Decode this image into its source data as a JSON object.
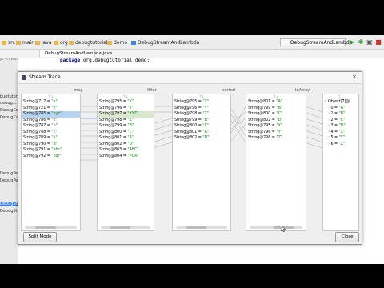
{
  "breadcrumbs": [
    {
      "label": "src"
    },
    {
      "label": "main"
    },
    {
      "label": "java"
    },
    {
      "label": "org"
    },
    {
      "label": "debugtutorial"
    },
    {
      "label": "demo"
    },
    {
      "label": "DebugStreamAndLambda"
    }
  ],
  "run_config": {
    "label": "DebugStreamAndLambda"
  },
  "editor_tab": {
    "label": "DebugStreamAndLambda.java"
  },
  "code_line": {
    "keyword": "package",
    "text": " org.debugtutorial.demo;"
  },
  "project_panel": {
    "path": "ju ~/Ideal.../tut/...",
    "items": [
      {
        "label": "bugtutorial"
      },
      {
        "label": "debug..."
      },
      {
        "label": "DebugCo"
      },
      {
        "label": "DebugCal"
      },
      {
        "label": "DebugPer"
      },
      {
        "label": "DebugPer"
      },
      {
        "label": "DebugStr"
      },
      {
        "label": "DebugStr"
      }
    ]
  },
  "dialog": {
    "title": "Stream Trace",
    "close_x": "×",
    "split_mode_label": "Split Mode",
    "close_label": "Close",
    "stages": [
      {
        "label": "map"
      },
      {
        "label": "filter"
      },
      {
        "label": "sorted"
      },
      {
        "label": "toArray"
      }
    ],
    "columns": [
      {
        "header": "↑↓",
        "rows": [
          {
            "obj": "String@717",
            "val": "\"a\""
          },
          {
            "obj": "String@721",
            "val": "\"y\""
          },
          {
            "obj": "String@785",
            "val": "\"xyz\""
          },
          {
            "obj": "String@786",
            "val": "\"z\""
          },
          {
            "obj": "String@787",
            "val": "\"b\""
          },
          {
            "obj": "String@788",
            "val": "\"c\""
          },
          {
            "obj": "String@789",
            "val": "\"a\""
          },
          {
            "obj": "String@790",
            "val": "\"d\""
          },
          {
            "obj": "String@791",
            "val": "\"abc\""
          },
          {
            "obj": "String@792",
            "val": "\"pqr\""
          }
        ]
      },
      {
        "header": "↑↓",
        "rows": [
          {
            "obj": "String@795",
            "val": "\"X\""
          },
          {
            "obj": "String@796",
            "val": "\"Y\""
          },
          {
            "obj": "String@797",
            "val": "\"XYZ\""
          },
          {
            "obj": "String@798",
            "val": "\"Z\""
          },
          {
            "obj": "String@799",
            "val": "\"B\""
          },
          {
            "obj": "String@800",
            "val": "\"C\""
          },
          {
            "obj": "String@801",
            "val": "\"A\""
          },
          {
            "obj": "String@802",
            "val": "\"D\""
          },
          {
            "obj": "String@803",
            "val": "\"ABC\""
          },
          {
            "obj": "String@804",
            "val": "\"PQR\""
          }
        ]
      },
      {
        "header": "↑↓",
        "rows": [
          {
            "obj": "String@795",
            "val": "\"X\""
          },
          {
            "obj": "String@796",
            "val": "\"Y\""
          },
          {
            "obj": "String@798",
            "val": "\"Z\""
          },
          {
            "obj": "String@799",
            "val": "\"B\""
          },
          {
            "obj": "String@800",
            "val": "\"C\""
          },
          {
            "obj": "String@801",
            "val": "\"A\""
          },
          {
            "obj": "String@802",
            "val": "\"D\""
          }
        ]
      },
      {
        "header": "↑↓",
        "rows": [
          {
            "obj": "String@801",
            "val": "\"A\""
          },
          {
            "obj": "String@799",
            "val": "\"B\""
          },
          {
            "obj": "String@800",
            "val": "\"C\""
          },
          {
            "obj": "String@802",
            "val": "\"D\""
          },
          {
            "obj": "String@795",
            "val": "\"X\""
          },
          {
            "obj": "String@796",
            "val": "\"Y\""
          },
          {
            "obj": "String@798",
            "val": "\"Z\""
          }
        ]
      },
      {
        "header": "↑↓",
        "rows": [
          {
            "obj": "Object[7]@",
            "val": ""
          },
          {
            "obj": "0 =",
            "val": "\"A\""
          },
          {
            "obj": "1 =",
            "val": "\"B\""
          },
          {
            "obj": "2 =",
            "val": "\"C\""
          },
          {
            "obj": "3 =",
            "val": "\"D\""
          },
          {
            "obj": "4 =",
            "val": "\"X\""
          },
          {
            "obj": "5 =",
            "val": "\"Y\""
          },
          {
            "obj": "6 =",
            "val": "\"Z\""
          }
        ]
      }
    ]
  },
  "colors": {
    "selection": "#b5d3f3",
    "string_value": "#1a7f1a",
    "accent": "#3d7fd6"
  }
}
